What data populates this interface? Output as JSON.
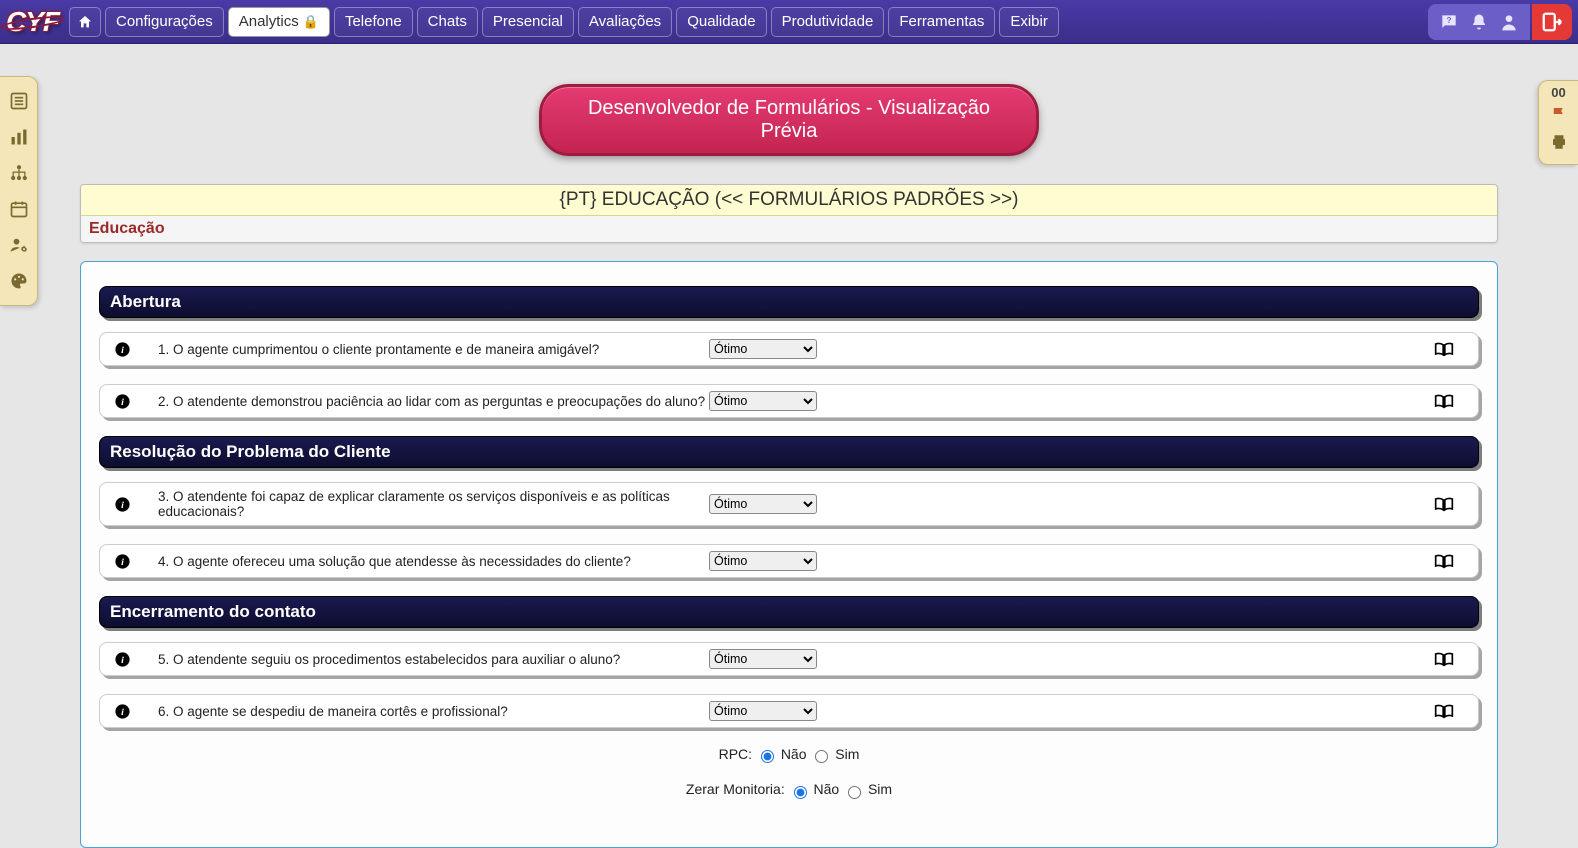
{
  "logo": "CYF",
  "nav": {
    "config": "Configurações",
    "analytics": "Analytics",
    "telefone": "Telefone",
    "chats": "Chats",
    "presencial": "Presencial",
    "avaliacoes": "Avaliações",
    "qualidade": "Qualidade",
    "produtividade": "Produtividade",
    "ferramentas": "Ferramentas",
    "exibir": "Exibir"
  },
  "right_sidebar": {
    "count": "00"
  },
  "page_title": "Desenvolvedor de Formulários - Visualização Prévia",
  "form_header": {
    "title": "{PT} EDUCAÇÃO (<< FORMULÁRIOS PADRÕES >>)",
    "subtitle": "Educação"
  },
  "select_value": "Ótimo",
  "sections": [
    {
      "title": "Abertura",
      "questions": [
        "1. O agente cumprimentou o cliente prontamente e de maneira amigável?",
        "2. O atendente demonstrou paciência ao lidar com as perguntas e preocupações do aluno?"
      ]
    },
    {
      "title": "Resolução do Problema do Cliente",
      "questions": [
        "3. O atendente foi capaz de explicar claramente os serviços disponíveis e as políticas educacionais?",
        "4. O agente ofereceu uma solução que atendesse às necessidades do cliente?"
      ]
    },
    {
      "title": "Encerramento do contato",
      "questions": [
        "5. O atendente seguiu os procedimentos estabelecidos para auxiliar o aluno?",
        "6. O agente se despediu de maneira cortês e profissional?"
      ]
    }
  ],
  "footer": {
    "rpc_label": "RPC:",
    "zerar_label": "Zerar Monitoria:",
    "nao": "Não",
    "sim": "Sim"
  }
}
